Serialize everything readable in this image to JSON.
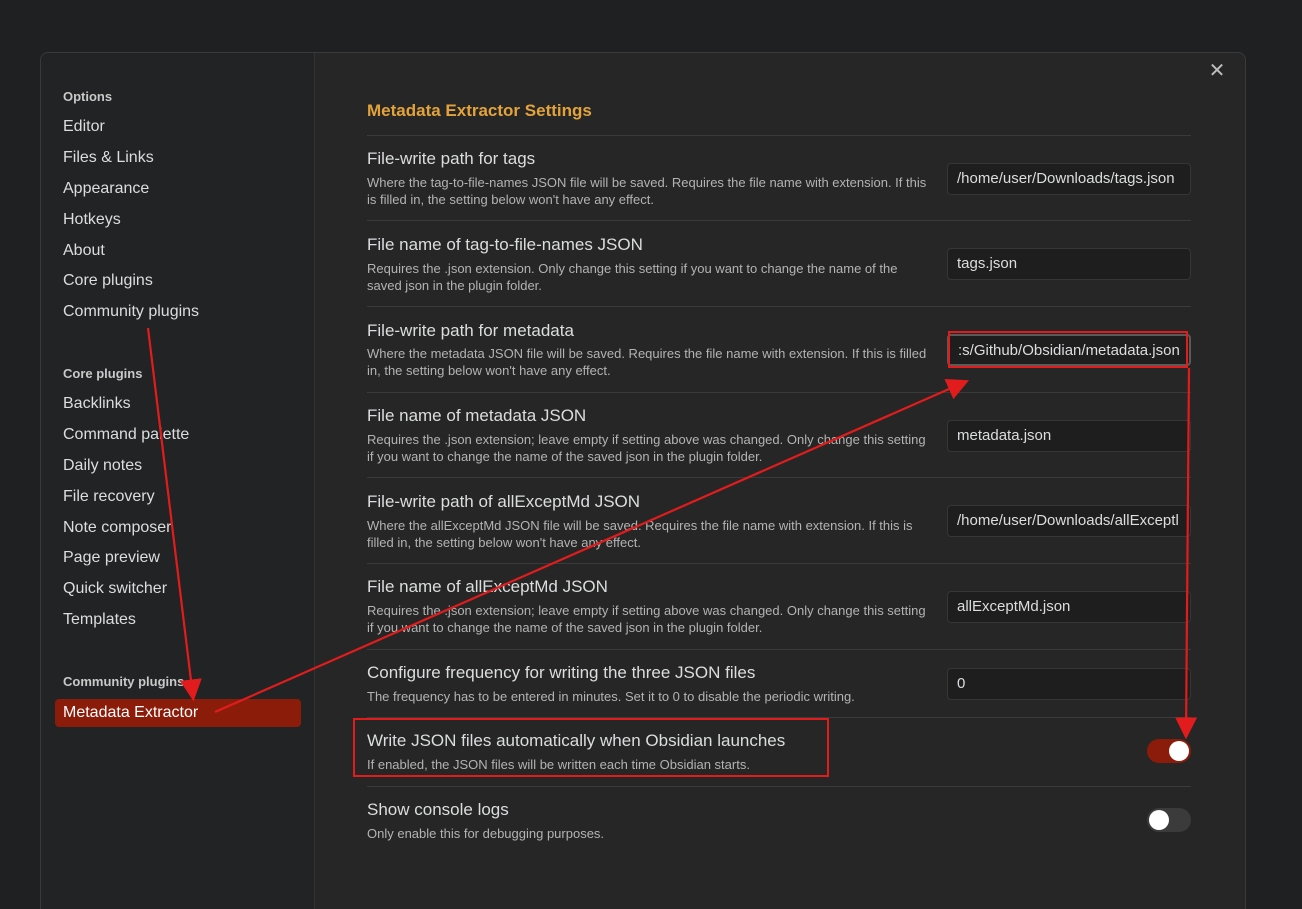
{
  "sidebar": {
    "groups": [
      {
        "title": "Options",
        "items": [
          "Editor",
          "Files & Links",
          "Appearance",
          "Hotkeys",
          "About",
          "Core plugins",
          "Community plugins"
        ]
      },
      {
        "title": "Core plugins",
        "items": [
          "Backlinks",
          "Command palette",
          "Daily notes",
          "File recovery",
          "Note composer",
          "Page preview",
          "Quick switcher",
          "Templates"
        ]
      },
      {
        "title": "Community plugins",
        "items": [
          "Metadata Extractor"
        ]
      }
    ],
    "active_item": "Metadata Extractor"
  },
  "content": {
    "title": "Metadata Extractor Settings",
    "close_icon": "close-icon",
    "settings": [
      {
        "name": "File-write path for tags",
        "desc": "Where the tag-to-file-names JSON file will be saved. Requires the file name with extension. If this is filled in, the setting below won't have any effect.",
        "value": "/home/user/Downloads/tags.json"
      },
      {
        "name": "File name of tag-to-file-names JSON",
        "desc": "Requires the .json extension. Only change this setting if you want to change the name of the saved json in the plugin folder.",
        "value": "tags.json"
      },
      {
        "name": "File-write path for metadata",
        "desc": "Where the metadata JSON file will be saved. Requires the file name with extension. If this is filled in, the setting below won't have any effect.",
        "value": ":s/Github/Obsidian/metadata.json"
      },
      {
        "name": "File name of metadata JSON",
        "desc": "Requires the .json extension; leave empty if setting above was changed. Only change this setting if you want to change the name of the saved json in the plugin folder.",
        "value": "metadata.json"
      },
      {
        "name": "File-write path of allExceptMd JSON",
        "desc": "Where the allExceptMd JSON file will be saved. Requires the file name with extension. If this is filled in, the setting below won't have any effect.",
        "value": "/home/user/Downloads/allExceptl"
      },
      {
        "name": "File name of allExceptMd JSON",
        "desc": "Requires the .json extension; leave empty if setting above was changed. Only change this setting if you want to change the name of the saved json in the plugin folder.",
        "value": "allExceptMd.json"
      },
      {
        "name": "Configure frequency for writing the three JSON files",
        "desc": "The frequency has to be entered in minutes. Set it to 0 to disable the periodic writing.",
        "value": "0"
      },
      {
        "name": "Write JSON files automatically when Obsidian launches",
        "desc": "If enabled, the JSON files will be written each time Obsidian starts.",
        "toggle": true
      },
      {
        "name": "Show console logs",
        "desc": "Only enable this for debugging purposes.",
        "toggle": false
      }
    ]
  },
  "colors": {
    "accent_title": "#e3a33a",
    "active_item_bg": "#8c1c0a",
    "annotation": "#e21c1c"
  }
}
